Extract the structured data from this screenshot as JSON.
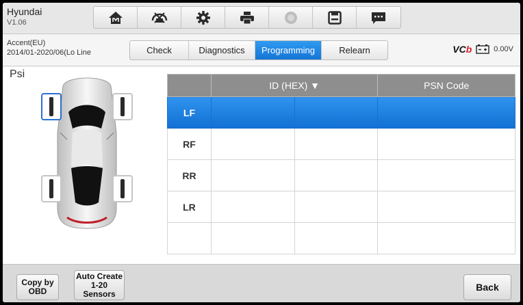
{
  "vehicle": {
    "make": "Hyundai",
    "version": "V1.06"
  },
  "toolbar": {
    "icons": [
      "home-icon",
      "vci-icon",
      "settings-icon",
      "print-icon",
      "help-icon",
      "save-icon",
      "message-icon"
    ]
  },
  "model": {
    "name": "Accent(EU)",
    "years": "2014/01-2020/06(Lo Line"
  },
  "tabs": [
    {
      "label": "Check",
      "active": false
    },
    {
      "label": "Diagnostics",
      "active": false
    },
    {
      "label": "Programming",
      "active": true
    },
    {
      "label": "Relearn",
      "active": false
    }
  ],
  "status": {
    "vcb_prefix": "VC",
    "vcb_suffix": "b",
    "voltage": "0.00V"
  },
  "main": {
    "unit": "Psi",
    "table": {
      "headers": [
        "",
        "ID (HEX) ▼",
        "PSN Code"
      ],
      "rows": [
        {
          "pos": "LF",
          "selected": true
        },
        {
          "pos": "RF",
          "selected": false
        },
        {
          "pos": "RR",
          "selected": false
        },
        {
          "pos": "LR",
          "selected": false
        },
        {
          "pos": "",
          "selected": false
        }
      ]
    }
  },
  "buttons": {
    "copy_obd": "Copy by OBD",
    "auto_create_l1": "Auto Create",
    "auto_create_l2": "1-20",
    "auto_create_l3": "Sensors",
    "back": "Back"
  },
  "colors": {
    "accent": "#1a7be0",
    "header_gray": "#8e8e8e",
    "vcb_red": "#d3202b"
  }
}
